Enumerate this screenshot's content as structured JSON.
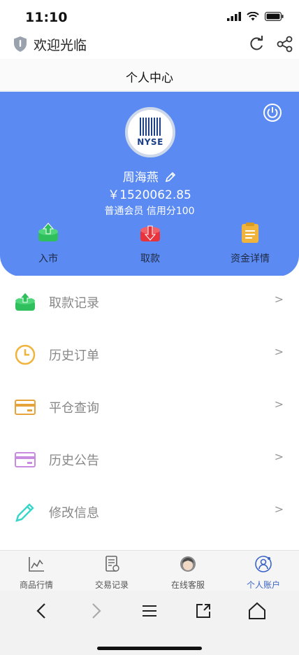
{
  "status": {
    "time": "11:10"
  },
  "browser": {
    "site_title": "欢迎光临"
  },
  "header": {
    "title": "个人中心"
  },
  "profile": {
    "name": "周海燕",
    "balance": "￥1520062.85",
    "member_info": "普通会员 信用分100",
    "logo_text": "NYSE",
    "actions": [
      {
        "label": "入市",
        "icon": "enter-market-icon",
        "color": "#2fbf5c"
      },
      {
        "label": "取款",
        "icon": "withdraw-icon",
        "color": "#e8333c"
      },
      {
        "label": "资金详情",
        "icon": "fund-details-icon",
        "color": "#f0b43c"
      }
    ]
  },
  "menu": [
    {
      "label": "取款记录",
      "icon": "withdraw-record-icon",
      "color": "#2fbf5c",
      "arrow": ">"
    },
    {
      "label": "历史订单",
      "icon": "clock-icon",
      "color": "#f0b43c",
      "arrow": ">"
    },
    {
      "label": "平仓查询",
      "icon": "card-icon",
      "color": "#e6a33a",
      "arrow": ">"
    },
    {
      "label": "历史公告",
      "icon": "card-icon",
      "color": "#c98be0",
      "arrow": ">"
    },
    {
      "label": "修改信息",
      "icon": "pencil-icon",
      "color": "#3ad6c8",
      "arrow": ">"
    }
  ],
  "tabs": [
    {
      "label": "商品行情",
      "icon": "chart-icon"
    },
    {
      "label": "交易记录",
      "icon": "document-icon"
    },
    {
      "label": "在线客服",
      "icon": "service-avatar-icon"
    },
    {
      "label": "个人账户",
      "icon": "account-icon",
      "active": true
    }
  ],
  "colors": {
    "primary": "#5b8bf2",
    "active_tab": "#3b64c8"
  }
}
